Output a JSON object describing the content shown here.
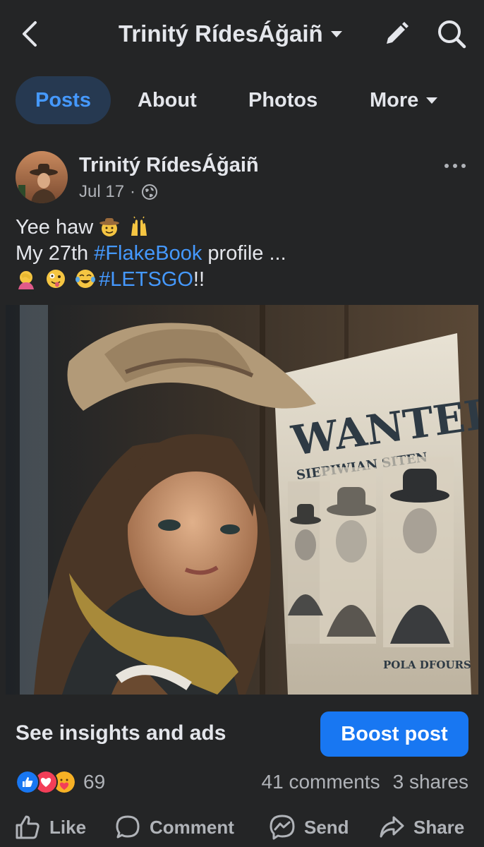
{
  "header": {
    "title": "Trinitý RídesÁğaiñ",
    "back_icon": "chevron-left-icon",
    "edit_icon": "pencil-icon",
    "search_icon": "search-icon"
  },
  "tabs": [
    {
      "label": "Posts",
      "active": true
    },
    {
      "label": "About",
      "active": false
    },
    {
      "label": "Photos",
      "active": false
    },
    {
      "label": "More",
      "active": false
    }
  ],
  "post": {
    "author": "Trinitý RídesÁğaiñ",
    "date": "Jul 17",
    "separator": "·",
    "audience_icon": "globe-icon",
    "text": {
      "line1": "Yee haw",
      "line2_prefix": "My 27th ",
      "line2_hashtag": "#FlakeBook",
      "line2_suffix": " profile ...",
      "line3_hashtag": "#LETSGO",
      "line3_suffix": "!!"
    },
    "image": {
      "poster_word": "WANTED",
      "poster_subtitle": "SIEPIWIAN SITEN",
      "poster_caption": "POLA DFOURS"
    }
  },
  "insights_label": "See insights and ads",
  "boost_label": "Boost post",
  "reactions": {
    "count": "69",
    "comments": "41 comments",
    "shares": "3 shares"
  },
  "actions": {
    "like": "Like",
    "comment": "Comment",
    "send": "Send",
    "share": "Share"
  },
  "colors": {
    "background": "#242526",
    "accent": "#1877f2",
    "hashtag": "#4599ff",
    "active_tab_bg": "#263951",
    "muted_text": "#b0b3b8"
  }
}
